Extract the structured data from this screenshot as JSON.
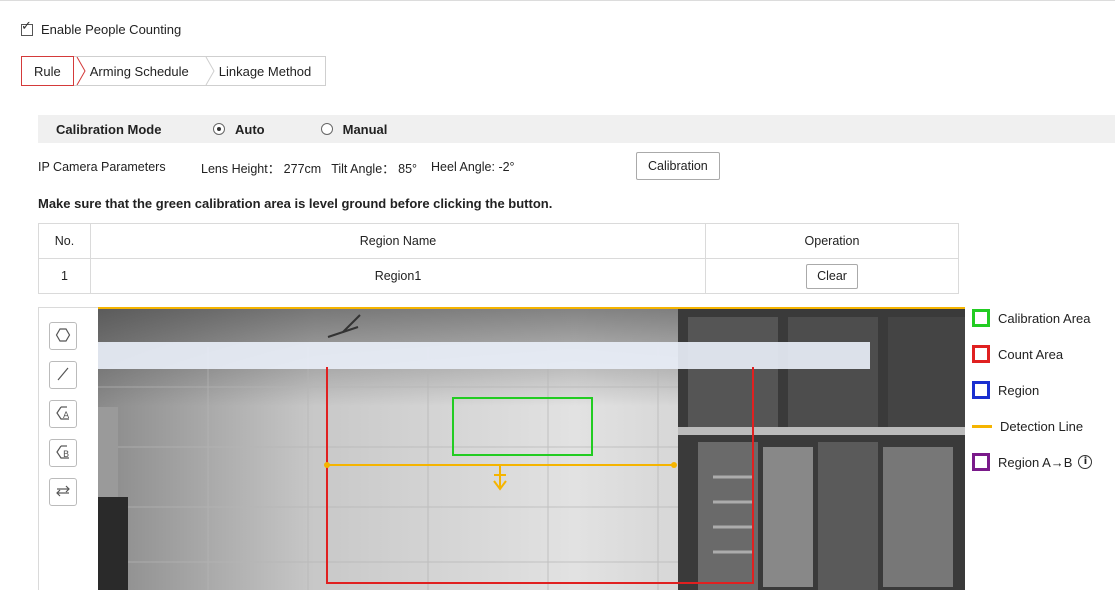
{
  "enable": {
    "label": "Enable People Counting",
    "checked": true
  },
  "tabs": [
    {
      "label": "Rule",
      "active": true
    },
    {
      "label": "Arming Schedule",
      "active": false
    },
    {
      "label": "Linkage Method",
      "active": false
    }
  ],
  "calibration": {
    "title": "Calibration Mode",
    "options": [
      {
        "label": "Auto",
        "selected": true
      },
      {
        "label": "Manual",
        "selected": false
      }
    ]
  },
  "params": {
    "title": "IP Camera Parameters",
    "lens_height": "Lens Height： 277cm",
    "tilt_angle": "Tilt Angle： 85°",
    "heel_angle": "Heel Angle: -2°",
    "button": "Calibration"
  },
  "hint": "Make sure that the green calibration area is level ground before clicking the button.",
  "table": {
    "headers": [
      "No.",
      "Region Name",
      "Operation"
    ],
    "rows": [
      {
        "no": "1",
        "name": "Region1",
        "action": "Clear"
      }
    ]
  },
  "tools": [
    "polygon-icon",
    "line-icon",
    "region-a-icon",
    "region-b-icon",
    "swap-direction-icon"
  ],
  "legend": [
    {
      "label": "Calibration Area",
      "color": "#22cc22",
      "kind": "box"
    },
    {
      "label": "Count Area",
      "color": "#e02020",
      "kind": "box"
    },
    {
      "label": "Region",
      "color": "#1a2fd0",
      "kind": "box"
    },
    {
      "label": "Detection Line",
      "color": "#f5b400",
      "kind": "line"
    },
    {
      "label": "Region A→B",
      "color": "#7a1a8a",
      "kind": "box",
      "info": true
    }
  ]
}
